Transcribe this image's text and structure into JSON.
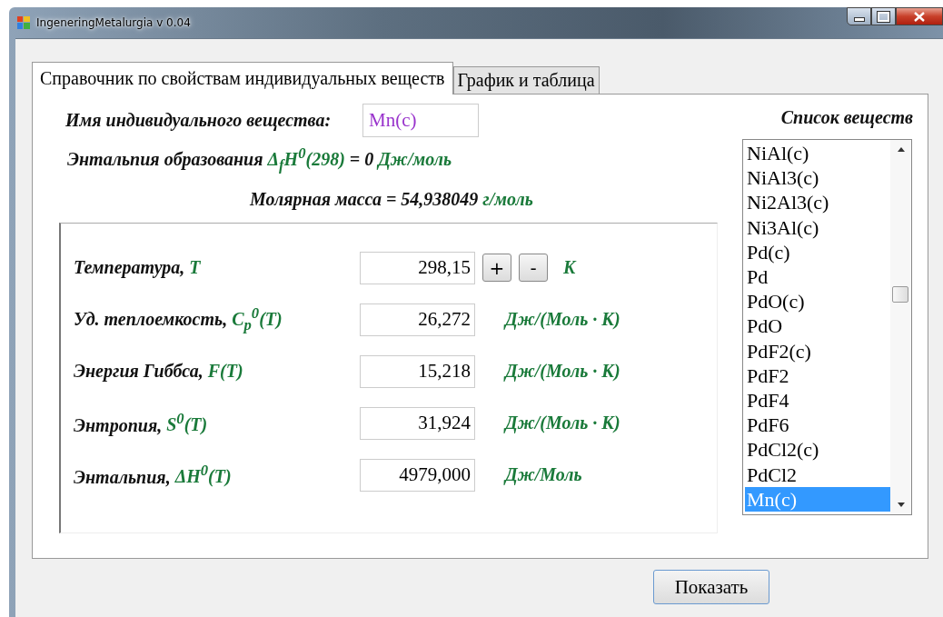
{
  "window": {
    "title": "IngeneringMetalurgia v 0.04"
  },
  "tabs": [
    {
      "label": "Справочник по свойствам индивидуальных веществ",
      "selected": true
    },
    {
      "label": "График и таблица",
      "selected": false
    }
  ],
  "substance": {
    "label": "Имя индивидуального вещества:",
    "value": "Mn(c)"
  },
  "formation_enthalpy": [
    {
      "kind": "name",
      "text": "Энтальпия образования "
    },
    {
      "kind": "symbol",
      "text": "Δ$_{f}$H$^{0}$(298)"
    },
    {
      "kind": "name",
      "text": " = 0 "
    },
    {
      "kind": "symbol",
      "text": "Дж/моль"
    }
  ],
  "molar_mass": [
    {
      "kind": "name",
      "text": "Молярная масса = 54,938049 "
    },
    {
      "kind": "symbol",
      "text": "г/моль"
    }
  ],
  "properties": [
    {
      "kind": "stepper",
      "label": [
        {
          "kind": "name",
          "text": "Температура, "
        },
        {
          "kind": "symbol",
          "text": "T"
        }
      ],
      "value": "298,15",
      "buttons": [
        "+",
        "-"
      ],
      "unit": "K"
    },
    {
      "kind": "plain",
      "label": [
        {
          "kind": "name",
          "text": "Уд. теплоемкость, "
        },
        {
          "kind": "symbol",
          "text": "C$_{p}$$^{0}$(T)"
        }
      ],
      "value": "26,272",
      "unit": "Дж/(Моль · К)"
    },
    {
      "kind": "plain",
      "label": [
        {
          "kind": "name",
          "text": "Энергия Гиббса, "
        },
        {
          "kind": "symbol",
          "text": "F(T)"
        }
      ],
      "value": "15,218",
      "unit": "Дж/(Моль · К)"
    },
    {
      "kind": "plain",
      "label": [
        {
          "kind": "name",
          "text": "Энтропия, "
        },
        {
          "kind": "symbol",
          "text": "S$^{0}$(T)"
        }
      ],
      "value": "31,924",
      "unit": "Дж/(Моль · К)"
    },
    {
      "kind": "plain",
      "label": [
        {
          "kind": "name",
          "text": "Энтальпия, "
        },
        {
          "kind": "symbol",
          "text": "ΔH$^{0}$(T)"
        }
      ],
      "value": "4979,000",
      "unit": "Дж/Моль"
    }
  ],
  "substance_list": {
    "title": "Список веществ",
    "items": [
      {
        "label": "NiAl(c)",
        "selected": false
      },
      {
        "label": "NiAl3(c)",
        "selected": false
      },
      {
        "label": "Ni2Al3(c)",
        "selected": false
      },
      {
        "label": "Ni3Al(c)",
        "selected": false
      },
      {
        "label": "Pd(c)",
        "selected": false
      },
      {
        "label": "Pd",
        "selected": false
      },
      {
        "label": "PdO(c)",
        "selected": false
      },
      {
        "label": "PdO",
        "selected": false
      },
      {
        "label": "PdF2(c)",
        "selected": false
      },
      {
        "label": "PdF2",
        "selected": false
      },
      {
        "label": "PdF4",
        "selected": false
      },
      {
        "label": "PdF6",
        "selected": false
      },
      {
        "label": "PdCl2(c)",
        "selected": false
      },
      {
        "label": "PdCl2",
        "selected": false
      },
      {
        "label": "Mn(c)",
        "selected": true
      }
    ]
  },
  "show_button": "Показать"
}
